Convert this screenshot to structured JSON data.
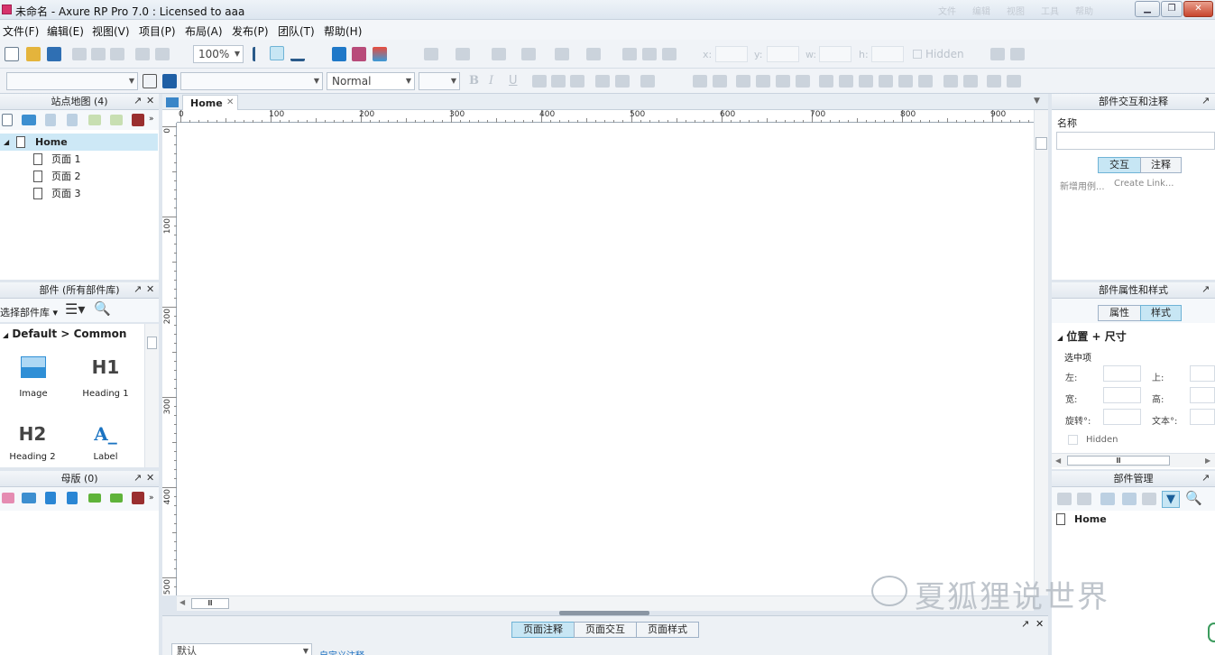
{
  "window": {
    "title": "未命名 - Axure RP Pro 7.0 : Licensed to aaa",
    "faint_tabs": [
      "文件",
      "编辑",
      "视图",
      "工具",
      "帮助"
    ],
    "controls": [
      "▁",
      "❐",
      "✕"
    ]
  },
  "menu": [
    "文件(F)",
    "编辑(E)",
    "视图(V)",
    "项目(P)",
    "布局(A)",
    "发布(P)",
    "团队(T)",
    "帮助(H)"
  ],
  "toolbar": {
    "zoom": "100%",
    "hidden_label": "Hidden",
    "font_style": "Normal",
    "coord_labels": [
      "x:",
      "y:",
      "w:",
      "h:"
    ]
  },
  "sitemap": {
    "title": "站点地图 (4)",
    "pages": [
      {
        "label": "Home",
        "selected": true,
        "level": 0
      },
      {
        "label": "页面 1",
        "selected": false,
        "level": 1
      },
      {
        "label": "页面 2",
        "selected": false,
        "level": 1
      },
      {
        "label": "页面 3",
        "selected": false,
        "level": 1
      }
    ]
  },
  "widgets": {
    "title": "部件 (所有部件库)",
    "library_select": "选择部件库",
    "group": "Default > Common",
    "items": [
      {
        "glyph": "",
        "label": "Image",
        "icon": "image-icon"
      },
      {
        "glyph": "H1",
        "label": "Heading 1",
        "icon": "heading1-icon"
      },
      {
        "glyph": "H2",
        "label": "Heading 2",
        "icon": "heading2-icon"
      },
      {
        "glyph": "A_",
        "label": "Label",
        "icon": "label-icon"
      }
    ]
  },
  "masters": {
    "title": "母版 (0)"
  },
  "canvas": {
    "tab": "Home",
    "ruler_h": [
      "0",
      "100",
      "200",
      "300",
      "400",
      "500",
      "600",
      "700",
      "800",
      "900"
    ],
    "ruler_v": [
      "0",
      "100",
      "200",
      "300",
      "400",
      "500"
    ]
  },
  "interactions_panel": {
    "title": "部件交互和注释",
    "name_label": "名称",
    "tabs": [
      "交互",
      "注释"
    ],
    "new_case": "新增用例...",
    "create_link": "Create Link..."
  },
  "properties_panel": {
    "title": "部件属性和样式",
    "tabs": [
      "属性",
      "样式"
    ],
    "section": "位置 + 尺寸",
    "selected_label": "选中项",
    "fields": [
      "左:",
      "上:",
      "宽:",
      "高:",
      "旋转°:",
      "文本°:"
    ],
    "hidden_label": "Hidden",
    "scroll_glyph": "Ⅲ"
  },
  "outline_panel": {
    "title": "部件管理",
    "items": [
      "Home"
    ]
  },
  "bottom_panel": {
    "tabs": [
      "页面注释",
      "页面交互",
      "页面样式"
    ],
    "select_value": "默认",
    "link": "自定义注释"
  },
  "watermark": "夏狐狸说世界",
  "colors": {
    "accent": "#6fb3d6",
    "selected_row": "#cde8f6",
    "canvas_bg": "#ffffff",
    "chrome_bg": "#dfe6ee"
  }
}
